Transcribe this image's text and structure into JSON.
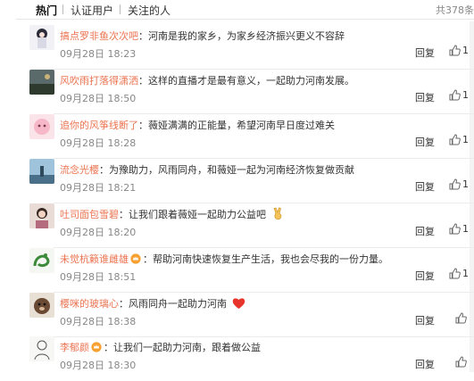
{
  "tabs": {
    "items": [
      {
        "label": "热门"
      },
      {
        "label": "认证用户"
      },
      {
        "label": "关注的人"
      }
    ],
    "total": "共378条"
  },
  "reply_label": "回复",
  "comments": [
    {
      "username": "搞点罗非鱼次次吧",
      "text": "河南是我的家乡，为家乡经济振兴更义不容辞",
      "time": "09月28日 18:23",
      "likes": "1",
      "avatar": "anime-girl-avatar",
      "emoji": ""
    },
    {
      "username": "风吹雨打落得潇洒",
      "text": "这样的直播才是最有意义，一起助力河南发展。",
      "time": "09月28日 18:50",
      "likes": "1",
      "avatar": "landscape-avatar",
      "emoji": ""
    },
    {
      "username": "追你的风筝线断了",
      "text": "薇娅满满的正能量，希望河南早日度过难关",
      "time": "09月28日 18:28",
      "likes": "1",
      "avatar": "pink-character-avatar",
      "emoji": ""
    },
    {
      "username": "流念光樱",
      "text": "为豫助力，风雨同舟，和薇娅一起为河南经济恢复做贡献",
      "time": "09月28日 18:21",
      "likes": "1",
      "avatar": "sky-avatar",
      "emoji": ""
    },
    {
      "username": "吐司面包雪碧",
      "text": "让我们跟着薇娅一起助力公益吧",
      "time": "09月28日 18:20",
      "likes": "1",
      "avatar": "portrait-avatar",
      "emoji": "victory-hand-emoji"
    },
    {
      "username": "未觉杭籁谁雌雄",
      "text": "帮助河南快速恢复生产生活，我也会尽我的一份力量。",
      "time": "09月28日 18:51",
      "likes": "1",
      "avatar": "green-pattern-avatar",
      "emoji": "",
      "vip": true
    },
    {
      "username": "樱咪的玻璃心",
      "text": "风雨同舟一起助力河南",
      "time": "09月28日 18:38",
      "likes": "",
      "avatar": "dog-avatar",
      "emoji": "red-heart-emoji"
    },
    {
      "username": "李郁颜",
      "text": "让我们一起助力河南，跟着做公益",
      "time": "09月28日 18:30",
      "likes": "",
      "avatar": "sketch-avatar",
      "emoji": "",
      "vip": true
    }
  ],
  "colors": {
    "username": "#eb7350",
    "text": "#333333",
    "meta": "#888888"
  }
}
